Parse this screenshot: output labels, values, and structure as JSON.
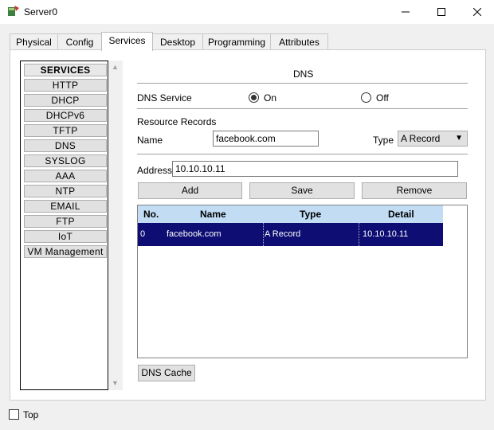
{
  "window": {
    "title": "Server0"
  },
  "tabs": [
    {
      "label": "Physical"
    },
    {
      "label": "Config"
    },
    {
      "label": "Services",
      "active": true
    },
    {
      "label": "Desktop"
    },
    {
      "label": "Programming"
    },
    {
      "label": "Attributes"
    }
  ],
  "services": {
    "header": "SERVICES",
    "items": [
      "HTTP",
      "DHCP",
      "DHCPv6",
      "TFTP",
      "DNS",
      "SYSLOG",
      "AAA",
      "NTP",
      "EMAIL",
      "FTP",
      "IoT",
      "VM Management"
    ]
  },
  "dns": {
    "title": "DNS",
    "service_label": "DNS Service",
    "on_label": "On",
    "off_label": "Off",
    "service_state": "On",
    "resource_records_label": "Resource Records",
    "name_label": "Name",
    "name_value": "facebook.com",
    "type_label": "Type",
    "type_value": "A Record",
    "address_label": "Address",
    "address_value": "10.10.10.11",
    "add_label": "Add",
    "save_label": "Save",
    "remove_label": "Remove",
    "table": {
      "columns": [
        "No.",
        "Name",
        "Type",
        "Detail"
      ],
      "rows": [
        {
          "no": "0",
          "name": "facebook.com",
          "type": "A Record",
          "detail": "10.10.10.11"
        }
      ]
    },
    "cache_label": "DNS Cache"
  },
  "footer": {
    "top_label": "Top",
    "top_checked": false
  }
}
